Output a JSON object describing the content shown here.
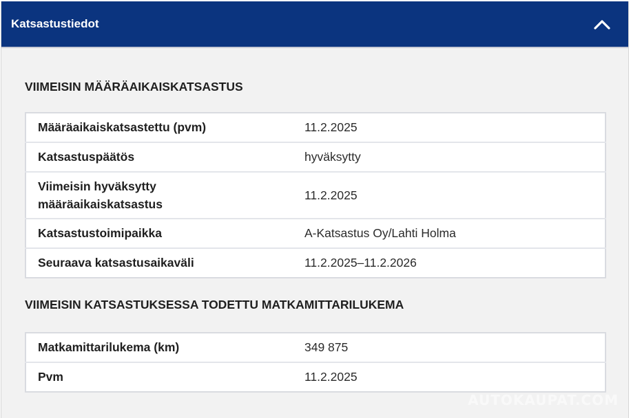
{
  "panel": {
    "title": "Katsastustiedot",
    "collapse_icon": "chevron-up-icon"
  },
  "inspection": {
    "heading": "VIIMEISIN MÄÄRÄAIKAISKATSASTUS",
    "rows": [
      {
        "label": "Määräaikaiskatsastettu (pvm)",
        "value": "11.2.2025"
      },
      {
        "label": "Katsastuspäätös",
        "value": "hyväksytty"
      },
      {
        "label": "Viimeisin hyväksytty määräaikaiskatsastus",
        "value": "11.2.2025"
      },
      {
        "label": "Katsastustoimipaikka",
        "value": "A-Katsastus Oy/Lahti Holma"
      },
      {
        "label": "Seuraava katsastusaikaväli",
        "value": "11.2.2025–11.2.2026"
      }
    ]
  },
  "odometer": {
    "heading": "VIIMEISIN KATSASTUKSESSA TODETTU MATKAMITTARILUKEMA",
    "rows": [
      {
        "label": "Matkamittarilukema (km)",
        "value": "349 875"
      },
      {
        "label": "Pvm",
        "value": "11.2.2025"
      }
    ]
  },
  "watermark": "AUTOKAUPAT.COM"
}
